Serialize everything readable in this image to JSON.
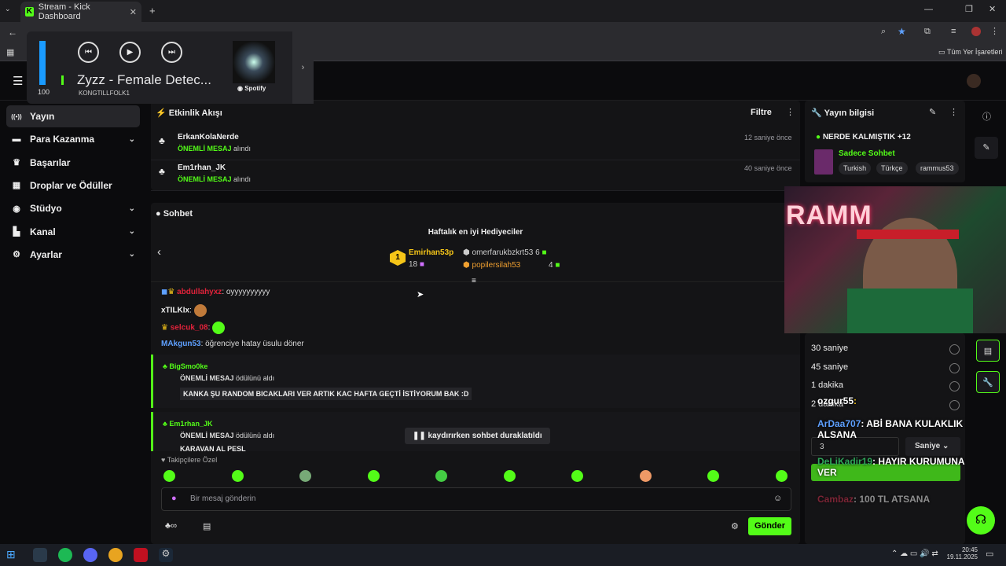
{
  "browser": {
    "tab_title": "Stream - Kick Dashboard",
    "bookmarks_label": "Tüm Yer İşaretleri"
  },
  "media": {
    "volume": "100",
    "title": "Zyzz - Female Detec...",
    "artist": "KONGTILLFOLK1",
    "service": "Spotify"
  },
  "sidebar": {
    "items": [
      {
        "label": "Yayın",
        "icon": "broadcast-icon",
        "active": true,
        "expandable": false
      },
      {
        "label": "Para Kazanma",
        "icon": "money-icon",
        "active": false,
        "expandable": true
      },
      {
        "label": "Başarılar",
        "icon": "trophy-icon",
        "active": false,
        "expandable": false
      },
      {
        "label": "Droplar ve Ödüller",
        "icon": "drops-icon",
        "active": false,
        "expandable": false
      },
      {
        "label": "Stüdyo",
        "icon": "studio-icon",
        "active": false,
        "expandable": true
      },
      {
        "label": "Kanal",
        "icon": "channel-icon",
        "active": false,
        "expandable": true
      },
      {
        "label": "Ayarlar",
        "icon": "settings-icon",
        "active": false,
        "expandable": true
      }
    ]
  },
  "activity": {
    "title": "Etkinlik Akışı",
    "filter": "Filtre",
    "events": [
      {
        "user": "ErkanKolaNerde",
        "badge": "ÖNEMLİ MESAJ",
        "action": "alındı",
        "time": "12 saniye önce"
      },
      {
        "user": "Em1rhan_JK",
        "badge": "ÖNEMLİ MESAJ",
        "action": "alındı",
        "time": "40 saniye önce"
      }
    ]
  },
  "chat": {
    "title": "Sohbet",
    "top_gifters_title": "Haftalık en iyi Hediyeciler",
    "gifters": [
      {
        "rank": "1",
        "name": "Emirhan53p",
        "count": "18"
      },
      {
        "name": "omerfarukbzkrt53",
        "count": "6"
      },
      {
        "name": "popilersilah53",
        "count": "4"
      }
    ],
    "messages": [
      {
        "user": "abdullahyxz",
        "text": ": oyyyyyyyyyy"
      },
      {
        "user": "xTILKIx",
        "text": ":"
      },
      {
        "user": "selcuk_08",
        "text": ":"
      },
      {
        "user": "MAkgun53",
        "text": ": öğrenciye hatay üsulu döner"
      }
    ],
    "highlights": [
      {
        "user": "BigSmo0ke",
        "label": "ÖNEMLİ MESAJ",
        "suffix": "ödülünü aldı",
        "text": "KANKA ŞU RANDOM BICAKLARI VER ARTIK KAC HAFTA GEÇTİ İSTİYORUM BAK :D"
      },
      {
        "user": "Em1rhan_JK",
        "label": "ÖNEMLİ MESAJ",
        "suffix": "ödülünü aldı",
        "text": "KARAVAN AL PESL"
      }
    ],
    "paused": "kaydırırken sohbet duraklatıldı",
    "followers_only": "Takipçilere Özel",
    "placeholder": "Bir mesaj gönderin",
    "send": "Gönder"
  },
  "stream_info": {
    "title": "Yayın bilgisi",
    "stream_title": "NERDE KALMIŞTIK +12",
    "category": "Sadece Sohbet",
    "tags": [
      "Turkish",
      "Türkçe",
      "rammus53"
    ]
  },
  "slow_mode": {
    "options": [
      "30 saniye",
      "45 saniye",
      "1 dakika",
      "2 dakika"
    ],
    "value": "3",
    "unit": "Saniye"
  },
  "overlay": {
    "cam_text": "RAMM",
    "chat": [
      {
        "user": "ozgur55",
        "text": ":"
      },
      {
        "user": "ArDaa707",
        "text": ": ABİ BANA KULAKLIK ALSANA"
      },
      {
        "user": "DeLiKadir19",
        "text": ": HAYIR KURUMUNA VER"
      },
      {
        "user": "Cambaz",
        "text": ": 100 TL ATSANA"
      }
    ]
  },
  "taskbar": {
    "time": "20:45",
    "date": "19.11.2025"
  },
  "colors": {
    "accent": "#53fc18",
    "bg": "#0b0b0d",
    "panel": "#141416"
  }
}
